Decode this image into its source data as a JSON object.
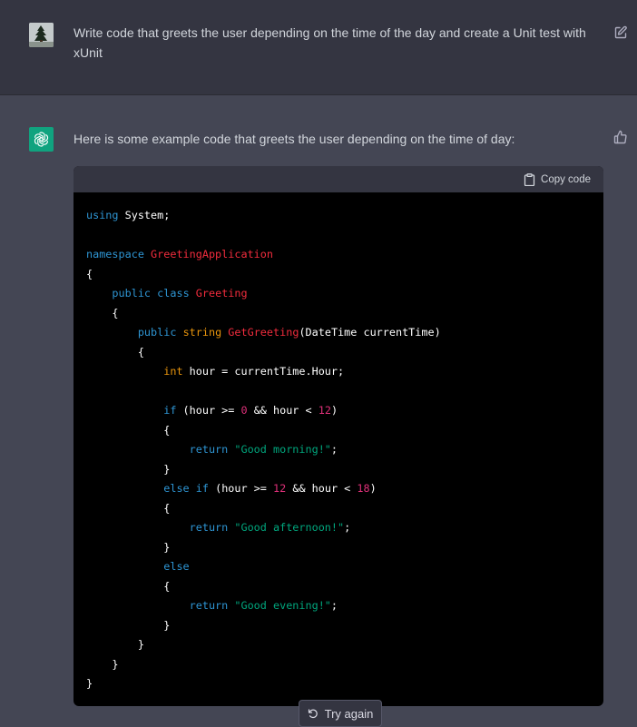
{
  "user_message": {
    "text_line1": "Write code that greets the user depending on the time of the day and create a Unit test with",
    "text_line2": "xUnit"
  },
  "assistant_message": {
    "intro": "Here is some example code that greets the user depending on the time of day:"
  },
  "code_block": {
    "copy_label": "Copy code",
    "tokens": {
      "using": "using",
      "system_ns": " System;",
      "namespace": "namespace",
      "ns_name": "GreetingApplication",
      "brace_open": "{",
      "brace_close": "}",
      "public": "public",
      "class": "class",
      "class_name": "Greeting",
      "string": "string",
      "method_name": "GetGreeting",
      "params": "(DateTime currentTime)",
      "int": "int",
      "hour_decl": " hour = currentTime.Hour;",
      "if": "if",
      "if_cond_a": " (hour >= ",
      "zero": "0",
      "and_hour_lt": " && hour < ",
      "twelve": "12",
      "close_paren": ")",
      "else": "else",
      "eighteen": "18",
      "return": "return",
      "morning": "\"Good morning!\"",
      "afternoon": "\"Good afternoon!\"",
      "evening": "\"Good evening!\"",
      "semicolon": ";"
    }
  },
  "try_again_label": "Try again"
}
